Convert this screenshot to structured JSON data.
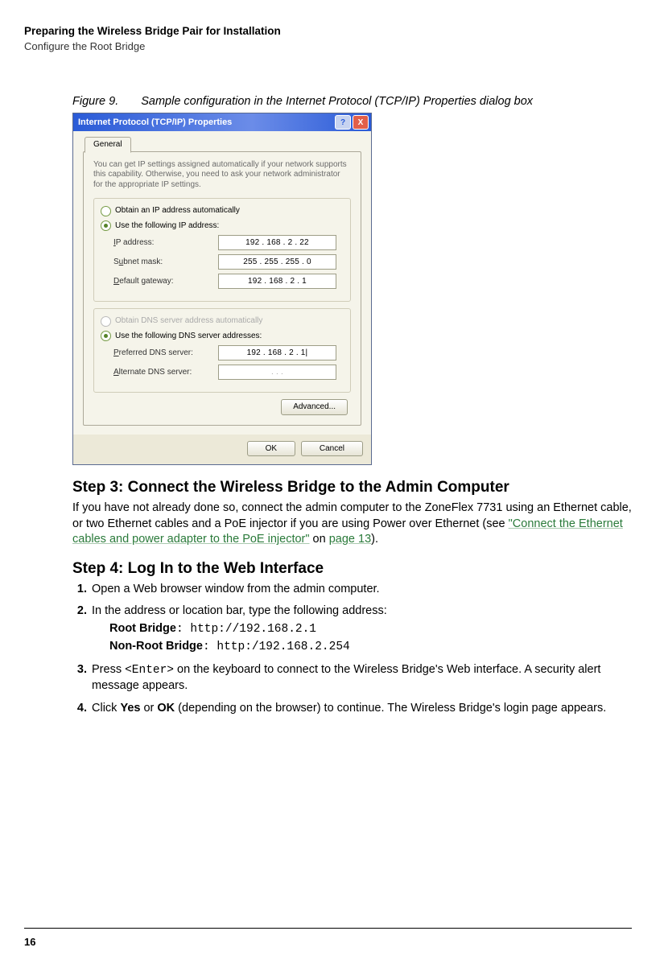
{
  "header": {
    "title": "Preparing the Wireless Bridge Pair for Installation",
    "subtitle": "Configure the Root Bridge"
  },
  "figure": {
    "label": "Figure 9.",
    "caption": "Sample configuration in the Internet Protocol (TCP/IP) Properties dialog box"
  },
  "dialog": {
    "title": "Internet Protocol (TCP/IP) Properties",
    "help": "?",
    "close": "X",
    "tab": "General",
    "desc": "You can get IP settings assigned automatically if your network supports this capability. Otherwise, you need to ask your network administrator for the appropriate IP settings.",
    "opt_auto_ip": "Obtain an IP address automatically",
    "opt_use_ip": "Use the following IP address:",
    "lbl_ip": "IP address:",
    "lbl_mask": "Subnet mask:",
    "lbl_gw": "Default gateway:",
    "val_ip": "192 . 168 .   2   .  22",
    "val_mask": "255 . 255 . 255 .   0",
    "val_gw": "192 . 168 .   2   .   1",
    "opt_auto_dns": "Obtain DNS server address automatically",
    "opt_use_dns": "Use the following DNS server addresses:",
    "lbl_pdns": "Preferred DNS server:",
    "lbl_adns": "Alternate DNS server:",
    "val_pdns": "192 . 168 .   2   .   1|",
    "val_adns": ".        .        .",
    "advanced": "Advanced...",
    "ok": "OK",
    "cancel": "Cancel"
  },
  "step3": {
    "heading": "Step 3: Connect the Wireless Bridge to the Admin Computer",
    "p1a": "If you have not already done so, connect the admin computer to the ZoneFlex 7731 using an Ethernet cable, or two Ethernet cables and a PoE injector if you are using Power over Ethernet (see ",
    "link1": "\"Connect the Ethernet cables and power adapter to the PoE injector\"",
    "p1b": " on ",
    "link2": "page 13",
    "p1c": ")."
  },
  "step4": {
    "heading": "Step 4: Log In to the Web Interface",
    "li1": "Open a Web browser window from the admin computer.",
    "li2": "In the address or location bar, type the following address:",
    "root_label": "Root Bridge",
    "root_url": "http://192.168.2.1",
    "nonroot_label": "Non-Root Bridge",
    "nonroot_url": "http:/192.168.2.254",
    "li3a": "Press ",
    "li3_enter": "<Enter>",
    "li3b": " on the keyboard to connect to the Wireless Bridge's Web interface. A security alert message appears.",
    "li4a": "Click ",
    "li4_yes": "Yes",
    "li4_or": " or ",
    "li4_ok": "OK",
    "li4b": " (depending on the browser) to continue. The Wireless Bridge's login page appears."
  },
  "page_number": "16",
  "colon": ": "
}
